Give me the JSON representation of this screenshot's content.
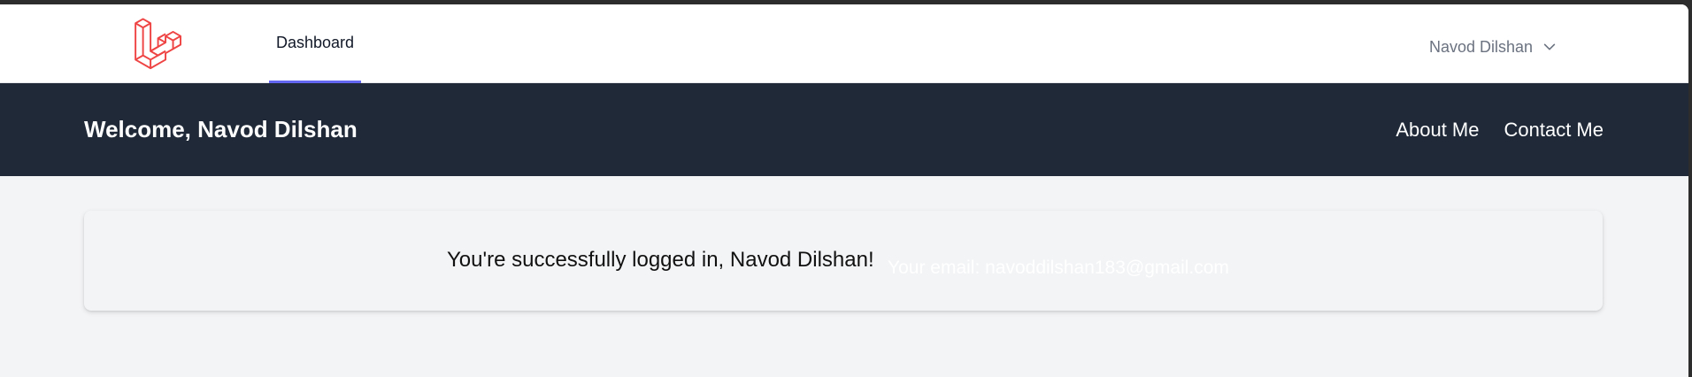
{
  "nav": {
    "logo_icon": "laravel-logo-icon",
    "dashboard_label": "Dashboard",
    "user_name": "Navod Dilshan",
    "user_menu_icon": "chevron-down-icon"
  },
  "header": {
    "welcome_text": "Welcome, Navod Dilshan",
    "links": [
      "About Me",
      "Contact Me"
    ]
  },
  "card": {
    "success_message": "You're successfully logged in, Navod Dilshan!",
    "email_message": "Your email: navoddilshan183@gmail.com"
  },
  "colors": {
    "accent": "#6366f1",
    "logo": "#ef4444",
    "header_bg": "#1f2937",
    "page_bg": "#f3f4f6"
  }
}
